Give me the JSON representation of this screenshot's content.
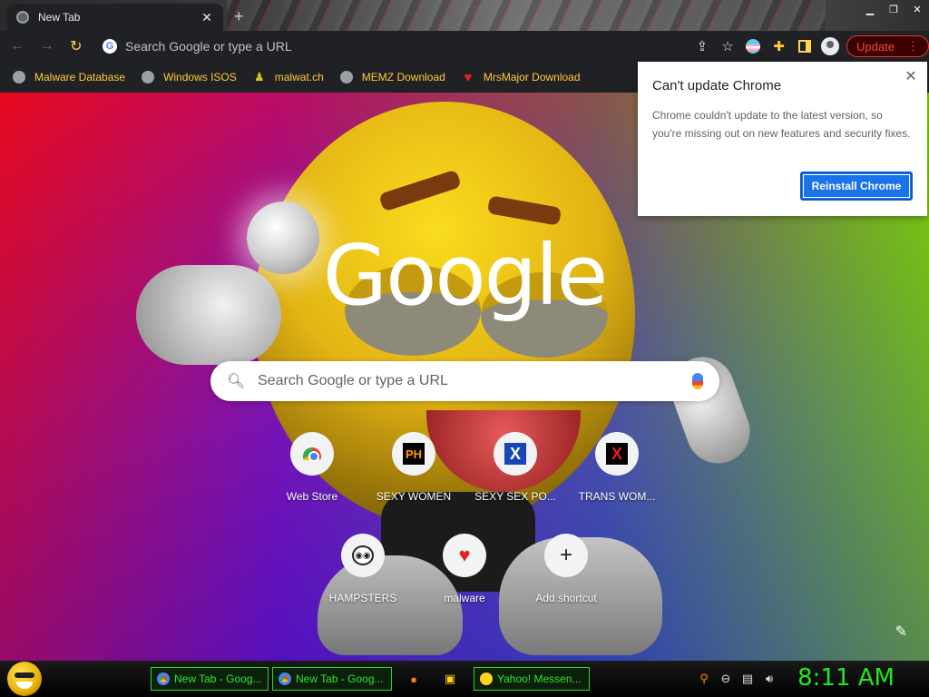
{
  "browser": {
    "tab_title": "New Tab",
    "tab_close": "✕",
    "new_tab_symbol": "+",
    "omnibox_placeholder": "Search Google or type a URL",
    "update_label": "Update",
    "update_menu": "⋮"
  },
  "bookmarks": [
    {
      "label": "Malware Database",
      "icon": "globe-icon"
    },
    {
      "label": "Windows ISOS",
      "icon": "globe-icon"
    },
    {
      "label": "malwat.ch",
      "icon": "person-icon"
    },
    {
      "label": "MEMZ Download",
      "icon": "globe-icon"
    },
    {
      "label": "MrsMajor Download",
      "icon": "heart-icon"
    }
  ],
  "newtab": {
    "logo": "Google",
    "search_placeholder": "Search Google or type a URL",
    "shortcuts": [
      {
        "label": "Web Store",
        "icon": "webstore-icon"
      },
      {
        "label": "SEXY WOMEN",
        "icon": "ph-icon",
        "glyph": "PH"
      },
      {
        "label": "SEXY SEX PO...",
        "icon": "x-blue-icon",
        "glyph": "X"
      },
      {
        "label": "TRANS WOM...",
        "icon": "x-red-icon",
        "glyph": "X"
      },
      {
        "label": "HAMPSTERS",
        "icon": "hamster-icon",
        "glyph": "◉◉"
      },
      {
        "label": "malware",
        "icon": "heart-icon",
        "glyph": "♥"
      },
      {
        "label": "Add shortcut",
        "icon": "plus-icon",
        "glyph": "+"
      }
    ]
  },
  "popup": {
    "title": "Can't update Chrome",
    "body": "Chrome couldn't update to the latest version, so you're missing out on new features and security fixes.",
    "button": "Reinstall Chrome",
    "close": "✕"
  },
  "taskbar": {
    "tasks": [
      {
        "label": "New Tab - Goog..."
      },
      {
        "label": "New Tab - Goog..."
      },
      {
        "label": "Yahoo! Messen..."
      }
    ],
    "clock": "8:11 AM"
  },
  "colors": {
    "accent_bookmark": "#ffca3a",
    "taskbar_green": "#2be72b",
    "update_red": "#ff4040",
    "popup_button": "#1a73e8"
  }
}
